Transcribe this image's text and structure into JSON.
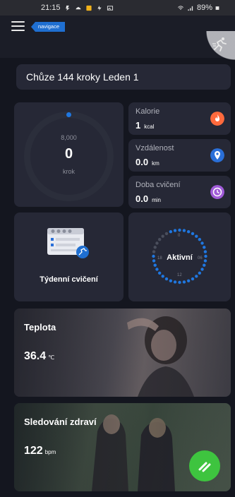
{
  "status_bar": {
    "time": "21:15",
    "battery": "89%"
  },
  "header": {
    "nav_chip": "navigace"
  },
  "title_card": {
    "text": "Chůze 144 kroky Leden 1"
  },
  "steps": {
    "goal": "8,000",
    "value": "0",
    "unit": "krok",
    "progress": 0
  },
  "stats": [
    {
      "label": "Kalorie",
      "value": "1",
      "unit": "kcal",
      "icon": "flame-icon",
      "color": "#ff6a3d"
    },
    {
      "label": "Vzdálenost",
      "value": "0.0",
      "unit": "km",
      "icon": "location-pin-icon",
      "color": "#2a6fd8"
    },
    {
      "label": "Doba cvičení",
      "value": "0.0",
      "unit": "min",
      "icon": "clock-icon",
      "color": "#a05bd8"
    }
  ],
  "weekly": {
    "label": "Týdenní cvičení"
  },
  "activity": {
    "label": "Aktivní",
    "marks": [
      "0",
      "06",
      "12",
      "18"
    ]
  },
  "temperature": {
    "title": "Teplota",
    "value": "36.4",
    "unit": "℃"
  },
  "health": {
    "title": "Sledování zdraví",
    "value": "122",
    "unit": "bpm"
  },
  "colors": {
    "accent": "#1f6fd1",
    "card": "#262836",
    "background": "#14161f",
    "fab": "#3ec43f",
    "ring": "#2b2e3b",
    "ring_dot": "#1f77e0"
  }
}
